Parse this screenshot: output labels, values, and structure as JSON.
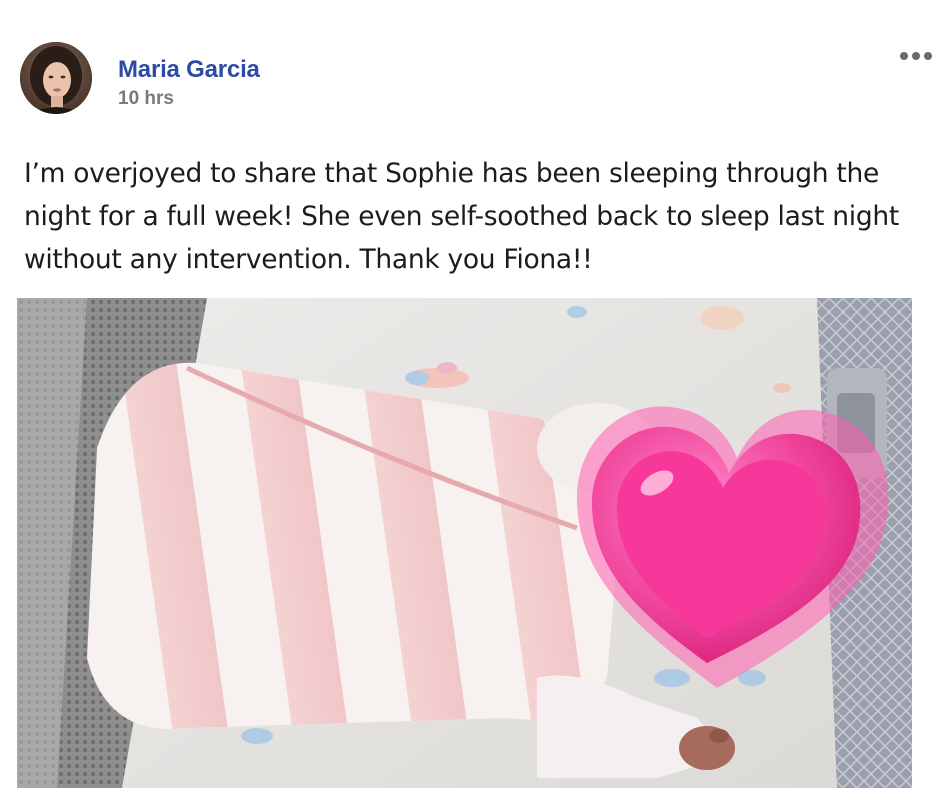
{
  "post": {
    "author": "Maria Garcia",
    "timestamp": "10 hrs",
    "text": "I’m overjoyed to share that Sophie has been sleeping through the night for a full week! She even self-soothed back to sleep last night without any intervention. Thank you Fiona!!",
    "menu_icon": "more-options-icon"
  },
  "colors": {
    "author_name": "#2d4aa6",
    "timestamp": "#7a7a7a",
    "text": "#1c1c1c",
    "heart": "#f0469b"
  },
  "photo": {
    "subject": "baby-sleeping-in-crib",
    "overlay_icon": "heart-emoji-icon"
  }
}
